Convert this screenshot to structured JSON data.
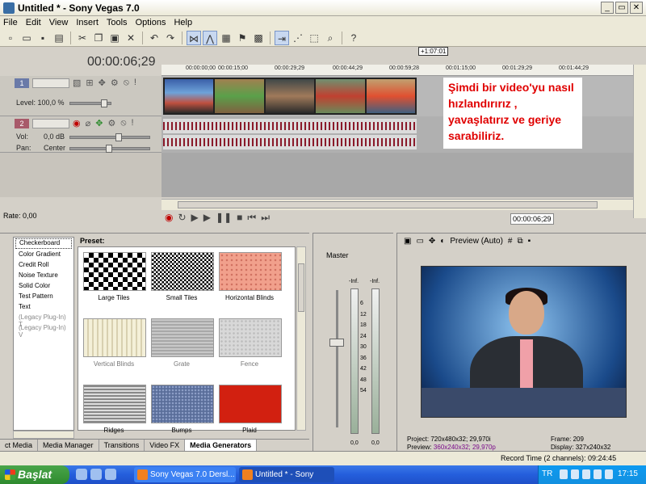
{
  "window": {
    "title": "Untitled * - Sony Vegas 7.0",
    "buttons": [
      "_",
      "▭",
      "✕"
    ]
  },
  "menu": [
    "File",
    "Edit",
    "View",
    "Insert",
    "Tools",
    "Options",
    "Help"
  ],
  "timeline": {
    "timecode": "00:00:06;29",
    "ruler_marks": [
      "00:00:00;00",
      "00:00:15;00",
      "00:00:29;29",
      "00:00:44;29",
      "00:00:59;28",
      "00:01:15;00",
      "00:01:29;29",
      "00:01:44;29"
    ],
    "marker": "+1:07:01",
    "video_track": {
      "number": "1",
      "level_label": "Level: 100,0 %"
    },
    "audio_track": {
      "number": "2",
      "vol_label": "Vol:",
      "vol_value": "0,0 dB",
      "pan_label": "Pan:",
      "pan_value": "Center"
    },
    "overlay_text": "Şimdi bir video'yu nasıl hızlandırırız , yavaşlatırız ve geriye sarabiliriz.",
    "rate": "Rate: 0,00",
    "transport_time": "00:00:06;29"
  },
  "generators": {
    "list": [
      {
        "label": "Checkerboard",
        "state": "selected"
      },
      {
        "label": "Color Gradient",
        "state": "normal"
      },
      {
        "label": "Credit Roll",
        "state": "normal"
      },
      {
        "label": "Noise Texture",
        "state": "normal"
      },
      {
        "label": "Solid Color",
        "state": "normal"
      },
      {
        "label": "Test Pattern",
        "state": "normal"
      },
      {
        "label": "Text",
        "state": "normal"
      },
      {
        "label": "(Legacy Plug-In) T",
        "state": "disabled"
      },
      {
        "label": "(Legacy Plug-In) V",
        "state": "disabled"
      }
    ],
    "preset_label": "Preset:",
    "presets": [
      "Large Tiles",
      "Small Tiles",
      "Horizontal Blinds",
      "Vertical Blinds",
      "Grate",
      "Fence",
      "Ridges",
      "Bumps",
      "Plaid"
    ]
  },
  "tabs": [
    "ct Media",
    "Media Manager",
    "Transitions",
    "Video FX",
    "Media Generators"
  ],
  "active_tab": "Media Generators",
  "mixer": {
    "master_label": "Master",
    "inf_left": "-Inf.",
    "inf_right": "-Inf.",
    "scale": [
      "6",
      "12",
      "18",
      "24",
      "30",
      "36",
      "42",
      "48",
      "54"
    ],
    "bottom_left": "0,0",
    "bottom_right": "0,0"
  },
  "preview": {
    "mode": "Preview (Auto)",
    "project": "Project:   720x480x32; 29,970i",
    "preview_label": "Preview:",
    "preview_value": "360x240x32; 29,970p",
    "frame_label": "Frame:",
    "frame_value": "209",
    "display_label": "Display:",
    "display_value": "327x240x32"
  },
  "status": {
    "record_time": "Record Time (2 channels): 09:24:45"
  },
  "taskbar": {
    "start": "Başlat",
    "tasks": [
      "Sony Vegas 7.0 Dersl...",
      "Untitled * - Sony Veg..."
    ],
    "lang": "TR",
    "clock": "17:15"
  }
}
